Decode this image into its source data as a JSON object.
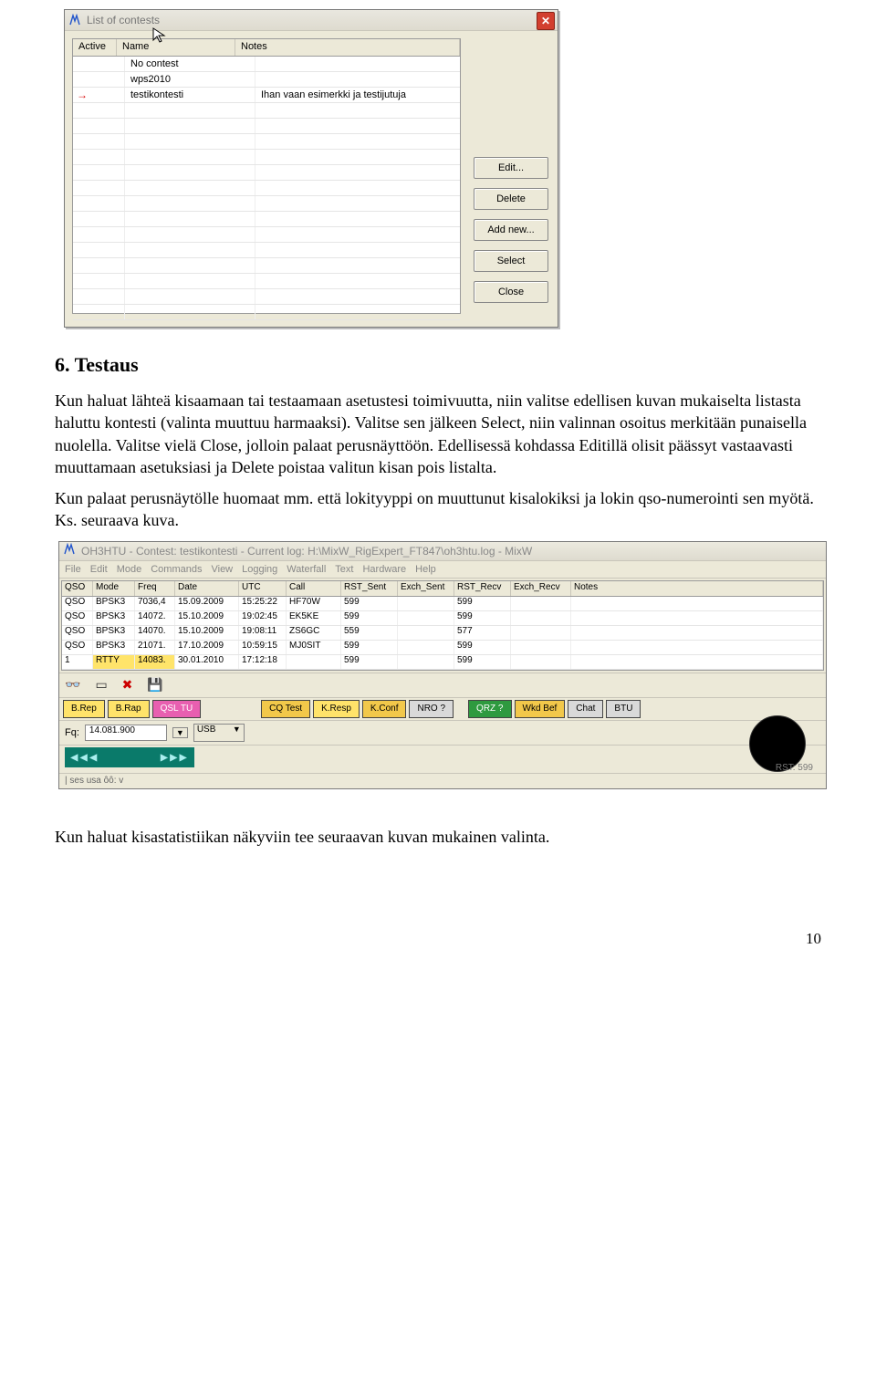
{
  "win1": {
    "title": "List of contests",
    "columns": {
      "active": "Active",
      "name": "Name",
      "notes": "Notes"
    },
    "rows": [
      {
        "active": "",
        "name": "No contest",
        "notes": ""
      },
      {
        "active": "",
        "name": "wps2010",
        "notes": ""
      },
      {
        "active": "→",
        "name": "testikontesti",
        "notes": "Ihan vaan esimerkki ja testijutuja"
      }
    ],
    "buttons": {
      "edit": "Edit...",
      "delete": "Delete",
      "addnew": "Add new...",
      "select": "Select",
      "close": "Close"
    }
  },
  "section_heading": "6. Testaus",
  "para1": "Kun haluat lähteä kisaamaan tai testaamaan asetustesi toimivuutta, niin valitse edellisen kuvan mukaiselta listasta haluttu kontesti (valinta muuttuu harmaaksi). Valitse sen jälkeen Select, niin valinnan osoitus merkitään punaisella nuolella. Valitse vielä Close, jolloin palaat perusnäyttöön. Edellisessä kohdassa Editillä  olisit päässyt vastaavasti muuttamaan asetuksiasi ja Delete poistaa valitun kisan pois listalta.",
  "para2": "Kun palaat perusnäytölle huomaat mm. että lokityyppi on muuttunut kisalokiksi ja lokin qso-numerointi sen myötä.  Ks. seuraava kuva.",
  "win2": {
    "title": "OH3HTU - Contest: testikontesti - Current log: H:\\MixW_RigExpert_FT847\\oh3htu.log - MixW",
    "menu": [
      "File",
      "Edit",
      "Mode",
      "Commands",
      "View",
      "Logging",
      "Waterfall",
      "Text",
      "Hardware",
      "Help"
    ],
    "logcols": [
      "QSO",
      "Mode",
      "Freq",
      "Date",
      "UTC",
      "Call",
      "RST_Sent",
      "Exch_Sent",
      "RST_Recv",
      "Exch_Recv",
      "Notes"
    ],
    "logrows": [
      {
        "qso": "QSO",
        "mode": "BPSK3",
        "freq": "7036,4",
        "date": "15.09.2009",
        "utc": "15:25:22",
        "call": "HF70W",
        "rsts": "599",
        "exs": "",
        "rstr": "599",
        "exr": "",
        "notes": ""
      },
      {
        "qso": "QSO",
        "mode": "BPSK3",
        "freq": "14072.",
        "date": "15.10.2009",
        "utc": "19:02:45",
        "call": "EK5KE",
        "rsts": "599",
        "exs": "",
        "rstr": "599",
        "exr": "",
        "notes": ""
      },
      {
        "qso": "QSO",
        "mode": "BPSK3",
        "freq": "14070.",
        "date": "15.10.2009",
        "utc": "19:08:11",
        "call": "ZS6GC",
        "rsts": "559",
        "exs": "",
        "rstr": "577",
        "exr": "",
        "notes": ""
      },
      {
        "qso": "QSO",
        "mode": "BPSK3",
        "freq": "21071.",
        "date": "17.10.2009",
        "utc": "10:59:15",
        "call": "MJ0SIT",
        "rsts": "599",
        "exs": "",
        "rstr": "599",
        "exr": "",
        "notes": ""
      },
      {
        "qso": "1",
        "mode": "RTTY",
        "freq": "14083.",
        "date": "30.01.2010",
        "utc": "17:12:18",
        "call": "",
        "rsts": "599",
        "exs": "",
        "rstr": "599",
        "exr": "",
        "notes": ""
      }
    ],
    "macros": [
      "B.Rep",
      "B.Rap",
      "QSL TU",
      "CQ Test",
      "K.Resp",
      "K.Conf",
      "NRO ?",
      "QRZ ?",
      "Wkd Bef",
      "Chat",
      "BTU"
    ],
    "freq_label": "Fq:",
    "freq_value": "14.081.900",
    "mode_value": "USB",
    "rst": "RST: 599",
    "status": "| ses usa ôô: v"
  },
  "para3": "Kun haluat kisastatistiikan näkyviin tee seuraavan kuvan mukainen valinta.",
  "page_number": "10"
}
